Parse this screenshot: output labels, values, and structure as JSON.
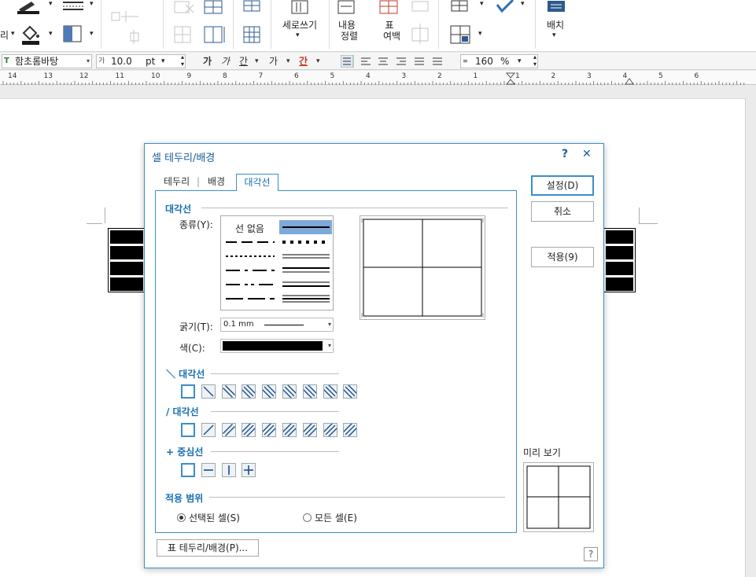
{
  "ribbon": {
    "vertical_writing": "세로쓰기",
    "content_align_1": "내용",
    "content_align_2": "정렬",
    "table_margin_1": "표",
    "table_margin_2": "여백",
    "arrange": "배치",
    "partial_left": "리"
  },
  "format_bar": {
    "font_name": "함초롬바탕",
    "font_size": "10.0",
    "size_unit": "pt",
    "line_spacing": "160",
    "spacing_unit": "%",
    "bold": "가",
    "italic": "가",
    "underline": "간",
    "strike": "가",
    "color": "간"
  },
  "ruler": {
    "numbers": [
      "14",
      "13",
      "12",
      "11",
      "10",
      "9",
      "8",
      "7",
      "6",
      "5",
      "4",
      "3",
      "2",
      "1",
      "1",
      "2",
      "3",
      "4",
      "5",
      "6"
    ]
  },
  "dialog": {
    "title": "셀 테두리/배경",
    "help": "?",
    "close": "✕",
    "tabs": [
      "테두리",
      "배경",
      "대각선"
    ],
    "section_diagonal": "대각선",
    "type_label": "종류(Y):",
    "no_line": "선 없음",
    "thickness_label": "굵기(T):",
    "thickness_value": "0.1 mm",
    "color_label": "색(C):",
    "backslash_section": "＼ 대각선",
    "slash_section": "/ 대각선",
    "center_section": "+ 중심선",
    "scope_section": "적용 범위",
    "scope_selected": "선택된 셀(S)",
    "scope_all": "모든 셀(E)",
    "btn_ok": "설정(D)",
    "btn_cancel": "취소",
    "btn_apply": "적용(9)",
    "preview_label": "미리 보기",
    "table_border_btn": "표 테두리/배경(P)...",
    "help_small": "?"
  }
}
